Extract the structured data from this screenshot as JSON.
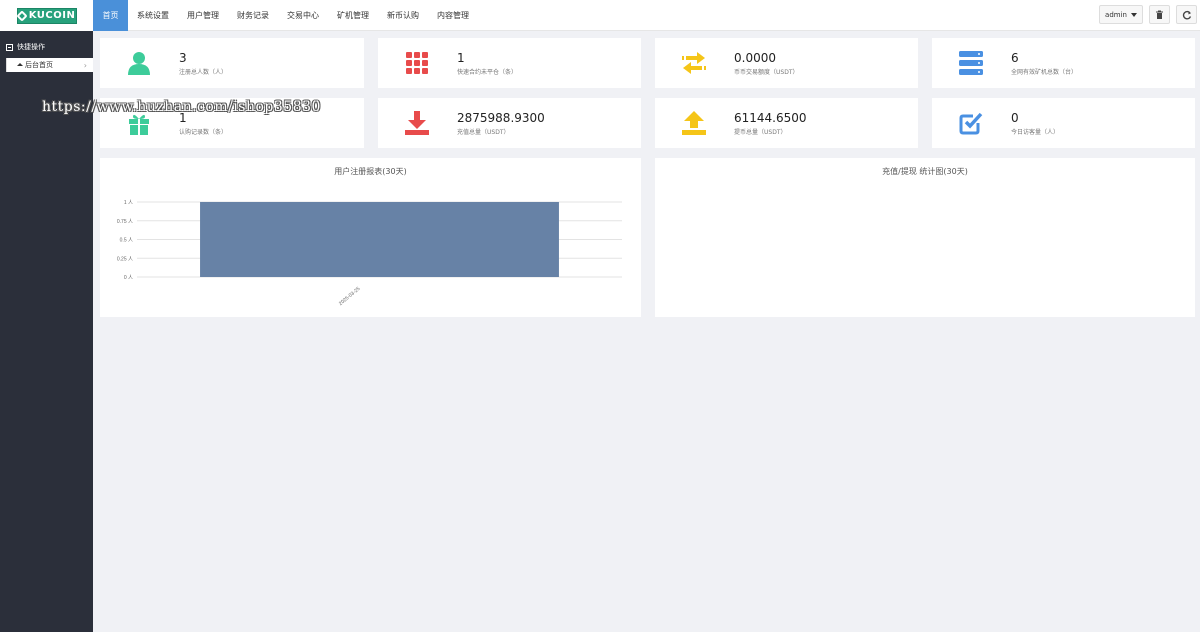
{
  "logo": {
    "text": "KUCOIN"
  },
  "sidebar": {
    "section_title": "快捷操作",
    "items": [
      {
        "label": "后台首页"
      }
    ]
  },
  "nav": {
    "items": [
      {
        "label": "首页",
        "active": true
      },
      {
        "label": "系统设置"
      },
      {
        "label": "用户管理"
      },
      {
        "label": "财务记录"
      },
      {
        "label": "交易中心"
      },
      {
        "label": "矿机管理"
      },
      {
        "label": "新币认购"
      },
      {
        "label": "内容管理"
      }
    ],
    "user_label": "admin"
  },
  "stats": [
    {
      "value": "3",
      "label": "注册总人数（人）",
      "icon": "user-icon",
      "color": "#3dcc9a"
    },
    {
      "value": "1",
      "label": "快速合约未平仓（条）",
      "icon": "grid-icon",
      "color": "#e84b4b"
    },
    {
      "value": "0.0000",
      "label": "币币交易额度（USDT）",
      "icon": "exchange-icon",
      "color": "#f5c518"
    },
    {
      "value": "6",
      "label": "全网有效矿机总数（台）",
      "icon": "server-icon",
      "color": "#4a90e2"
    },
    {
      "value": "1",
      "label": "认购记录数（条）",
      "icon": "gift-icon",
      "color": "#3dcc9a"
    },
    {
      "value": "2875988.9300",
      "label": "充值总量（USDT）",
      "icon": "download-icon",
      "color": "#e84b4b"
    },
    {
      "value": "61144.6500",
      "label": "提币总量（USDT）",
      "icon": "upload-icon",
      "color": "#f5c518"
    },
    {
      "value": "0",
      "label": "今日访客量（人）",
      "icon": "check-icon",
      "color": "#4a90e2"
    }
  ],
  "charts": {
    "registration": {
      "title": "用户注册报表(30天)"
    },
    "recharge": {
      "title": "充值/提现 统计图(30天)"
    }
  },
  "chart_data": [
    {
      "type": "bar",
      "title": "用户注册报表(30天)",
      "categories": [
        "2025-03-25"
      ],
      "values": [
        1
      ],
      "y_ticks": [
        "1 人",
        "0.75 人",
        "0.5 人",
        "0.25 人",
        "0 人"
      ],
      "ylim": [
        0,
        1
      ],
      "grid": true,
      "color": "#6782a6"
    },
    {
      "type": "bar",
      "title": "充值/提现 统计图(30天)",
      "categories": [],
      "values": []
    }
  ],
  "watermark": "https://www.huzhan.com/ishop35830"
}
